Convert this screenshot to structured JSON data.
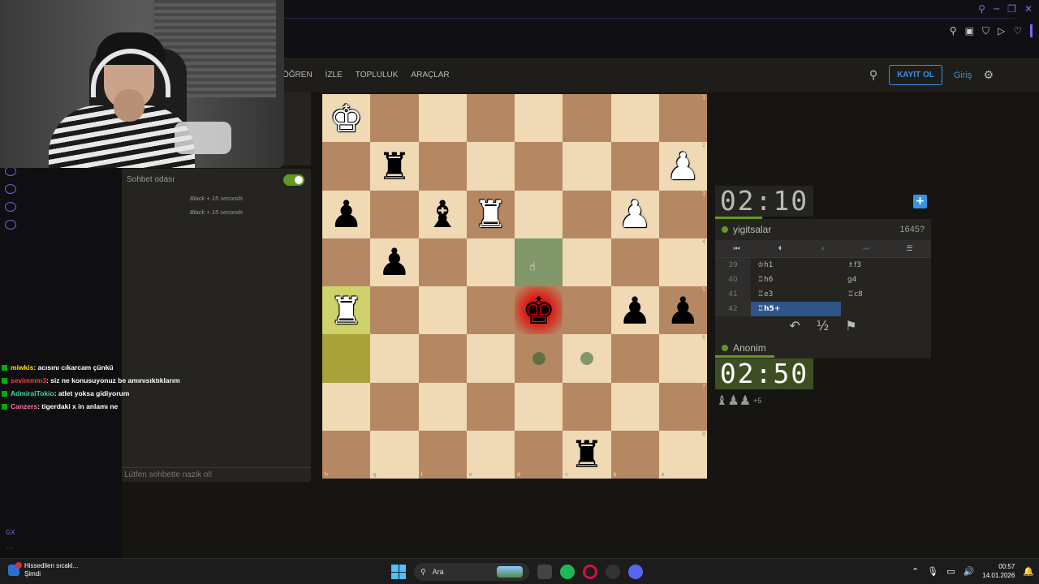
{
  "site_nav": [
    "ÖĞREN",
    "İZLE",
    "TOPLULUK",
    "ARAÇLAR"
  ],
  "header": {
    "register": "KAYIT OL",
    "login": "Giriş"
  },
  "chat": {
    "title": "Sohbet odası",
    "messages": [
      "Black + 15 seconds",
      "Black + 15 seconds"
    ],
    "placeholder": "Lütfen sohbette nazik ol!"
  },
  "stream_chat": [
    {
      "user": "miwkis",
      "color": "#ffe000",
      "text": ": acısını cıkarcam çünkü"
    },
    {
      "user": "sevimmm3",
      "color": "#ff3b3b",
      "text": ": siz ne konusuyonuz be amınısıktıklarım"
    },
    {
      "user": "AdmiralTokio",
      "color": "#3ddc97",
      "text": ": atlet yoksa gidiyorum"
    },
    {
      "user": "Canzers",
      "color": "#ff6fa1",
      "text": ": tigerdaki x in anlamı ne"
    }
  ],
  "board": {
    "ranks": [
      "1",
      "2",
      "3",
      "4",
      "5",
      "6",
      "7",
      "8"
    ],
    "files": [
      "h",
      "g",
      "f",
      "e",
      "d",
      "c",
      "b",
      "a"
    ],
    "pieces": [
      {
        "r": 0,
        "c": 0,
        "p": "♚",
        "side": "w"
      },
      {
        "r": 1,
        "c": 1,
        "p": "♜",
        "side": "b"
      },
      {
        "r": 1,
        "c": 7,
        "p": "♟",
        "side": "w"
      },
      {
        "r": 2,
        "c": 0,
        "p": "♟",
        "side": "b"
      },
      {
        "r": 2,
        "c": 2,
        "p": "♝",
        "side": "b"
      },
      {
        "r": 2,
        "c": 3,
        "p": "♜",
        "side": "w"
      },
      {
        "r": 2,
        "c": 6,
        "p": "♟",
        "side": "w"
      },
      {
        "r": 3,
        "c": 1,
        "p": "♟",
        "side": "b"
      },
      {
        "r": 4,
        "c": 0,
        "p": "♜",
        "side": "w"
      },
      {
        "r": 4,
        "c": 4,
        "p": "♚",
        "side": "b"
      },
      {
        "r": 4,
        "c": 6,
        "p": "♟",
        "side": "b"
      },
      {
        "r": 4,
        "c": 7,
        "p": "♟",
        "side": "b"
      },
      {
        "r": 7,
        "c": 5,
        "p": "♜",
        "side": "b"
      }
    ],
    "last_move": [
      [
        4,
        0
      ],
      [
        5,
        0
      ]
    ],
    "selected": [
      3,
      4
    ],
    "check": [
      4,
      4
    ],
    "dots": [
      [
        5,
        4
      ],
      [
        5,
        5
      ]
    ]
  },
  "top_player": {
    "name": "yigitsalar",
    "rating": "1645?",
    "clock_min": "02",
    "clock_sec": "10",
    "clock_fill": 0.48
  },
  "bottom_player": {
    "name": "Anonim",
    "clock_min": "02",
    "clock_sec": "50",
    "clock_fill": 0.6
  },
  "moves": [
    {
      "num": "39",
      "white": "♔h1",
      "black": "♗f3"
    },
    {
      "num": "40",
      "white": "♖h6",
      "black": "g4"
    },
    {
      "num": "41",
      "white": "♖e3",
      "black": "♖c8"
    },
    {
      "num": "42",
      "white": "♖h5+",
      "black": ""
    }
  ],
  "captured": {
    "count": "+5"
  },
  "taskbar": {
    "weather": "Hissedilen sıcakl...",
    "weather_sub": "Şimdi",
    "search": "Ara",
    "time": "00:57",
    "date": "14.01.2026"
  },
  "colors": {
    "accent": "#3692e7",
    "green": "#629924",
    "board_light": "#f0d9b5",
    "board_dark": "#b58863"
  }
}
